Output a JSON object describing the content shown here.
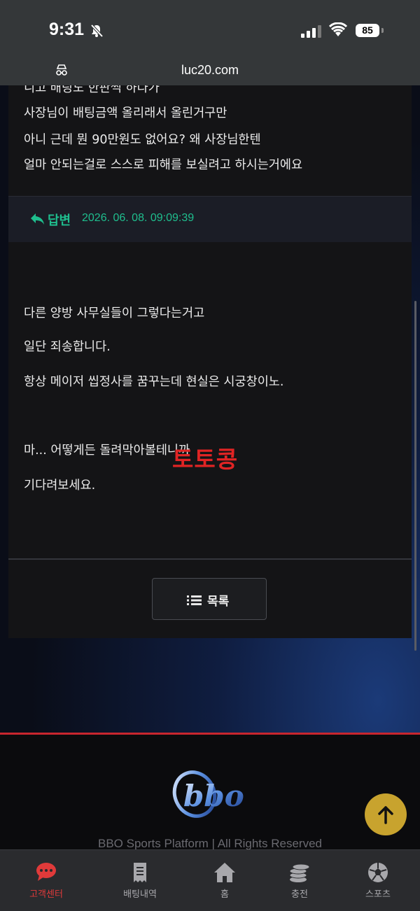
{
  "status_bar": {
    "time": "9:31",
    "battery": "85"
  },
  "browser": {
    "url": "luc20.com"
  },
  "post": {
    "lines": [
      "니고 배팅도 한판씩 하다가",
      "사장님이 배팅금액 올리래서 올린거구만",
      "아니 근데 뭔 90만원도 없어요? 왜 사장님한텐",
      "얼마 안되는걸로 스스로 피해를 보실려고 하시는거에요"
    ]
  },
  "reply": {
    "label": "답변",
    "date": "2026. 06. 08. 09:09:39",
    "lines": [
      "다른 양방 사무실들이 그렇다는거고",
      "일단 죄송합니다.",
      "항상 메이저 씹정사를 꿈꾸는데 현실은 시궁창이노.",
      "마... 어떻게든 돌려막아볼테니까",
      "기다려보세요."
    ]
  },
  "list_button": {
    "label": "목록"
  },
  "watermark": "토토콩",
  "footer": {
    "logo_text": "bbo",
    "copyright": "BBO Sports Platform | All Rights Reserved"
  },
  "colors": {
    "accent_red": "#e03a3a",
    "reply_green": "#1fbe8e",
    "fab_gold": "#c8a32e"
  },
  "tabs": [
    {
      "label": "고객센터",
      "icon": "chat-icon",
      "active": true
    },
    {
      "label": "배팅내역",
      "icon": "receipt-icon",
      "active": false
    },
    {
      "label": "홈",
      "icon": "home-icon",
      "active": false
    },
    {
      "label": "충전",
      "icon": "coins-icon",
      "active": false
    },
    {
      "label": "스포츠",
      "icon": "soccer-ball-icon",
      "active": false
    }
  ]
}
